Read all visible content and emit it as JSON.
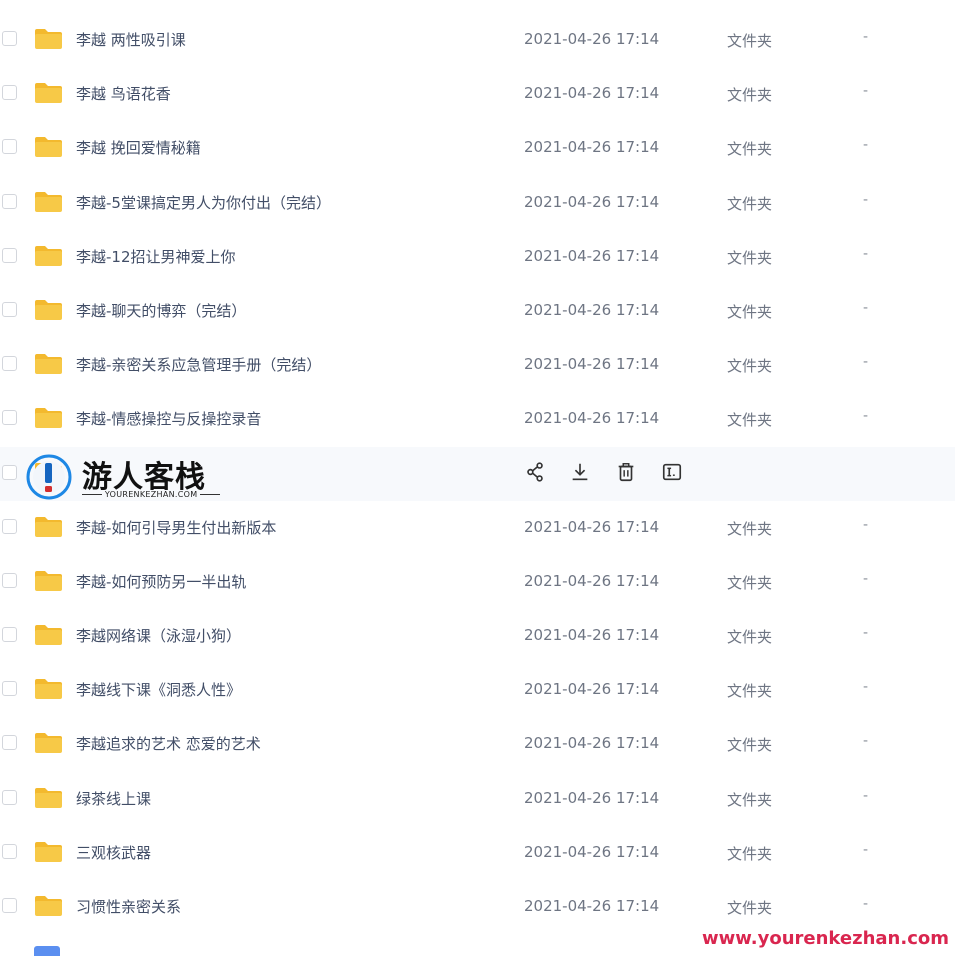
{
  "colors": {
    "folder": "#f7c947",
    "folder_tab": "#f3b92e",
    "text": "#424e67",
    "muted": "#6e7583",
    "watermark_red": "#d9264f"
  },
  "files": [
    {
      "name": "李越 两性吸引课",
      "date": "2021-04-26 17:14",
      "type": "文件夹",
      "size": "-"
    },
    {
      "name": "李越 鸟语花香",
      "date": "2021-04-26 17:14",
      "type": "文件夹",
      "size": "-"
    },
    {
      "name": "李越 挽回爱情秘籍",
      "date": "2021-04-26 17:14",
      "type": "文件夹",
      "size": "-"
    },
    {
      "name": "李越-5堂课搞定男人为你付出（完结）",
      "date": "2021-04-26 17:14",
      "type": "文件夹",
      "size": "-"
    },
    {
      "name": "李越-12招让男神爱上你",
      "date": "2021-04-26 17:14",
      "type": "文件夹",
      "size": "-"
    },
    {
      "name": "李越-聊天的博弈（完结）",
      "date": "2021-04-26 17:14",
      "type": "文件夹",
      "size": "-"
    },
    {
      "name": "李越-亲密关系应急管理手册（完结）",
      "date": "2021-04-26 17:14",
      "type": "文件夹",
      "size": "-"
    },
    {
      "name": "李越-情感操控与反操控录音",
      "date": "2021-04-26 17:14",
      "type": "文件夹",
      "size": "-"
    },
    {
      "name": "",
      "date": "",
      "type": "",
      "size": "",
      "hovered": true
    },
    {
      "name": "李越-如何引导男生付出新版本",
      "date": "2021-04-26 17:14",
      "type": "文件夹",
      "size": "-"
    },
    {
      "name": "李越-如何预防另一半出轨",
      "date": "2021-04-26 17:14",
      "type": "文件夹",
      "size": "-"
    },
    {
      "name": "李越网络课（泳湿小狗）",
      "date": "2021-04-26 17:14",
      "type": "文件夹",
      "size": "-"
    },
    {
      "name": "李越线下课《洞悉人性》",
      "date": "2021-04-26 17:14",
      "type": "文件夹",
      "size": "-"
    },
    {
      "name": "李越追求的艺术 恋爱的艺术",
      "date": "2021-04-26 17:14",
      "type": "文件夹",
      "size": "-"
    },
    {
      "name": "绿茶线上课",
      "date": "2021-04-26 17:14",
      "type": "文件夹",
      "size": "-"
    },
    {
      "name": "三观核武器",
      "date": "2021-04-26 17:14",
      "type": "文件夹",
      "size": "-"
    },
    {
      "name": "习惯性亲密关系",
      "date": "2021-04-26 17:14",
      "type": "文件夹",
      "size": "-"
    }
  ],
  "hover_actions": [
    {
      "icon": "share-icon"
    },
    {
      "icon": "download-icon"
    },
    {
      "icon": "delete-icon"
    },
    {
      "icon": "rename-icon"
    }
  ],
  "watermark": {
    "title": "游人客栈",
    "subtitle": "YOURENKEZHAN.COM",
    "url": "www.yourenkezhan.com"
  }
}
